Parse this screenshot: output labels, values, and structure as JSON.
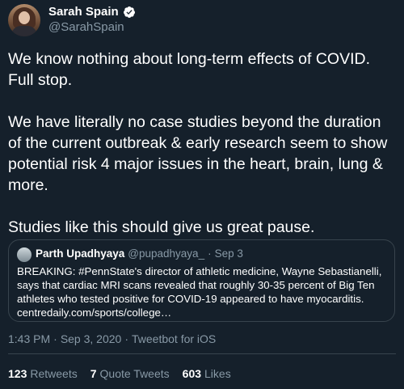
{
  "author": {
    "name": "Sarah Spain",
    "handle": "@SarahSpain",
    "avatar_icon": "profile-photo",
    "verified_icon": "verified-badge-icon"
  },
  "tweet": {
    "text": "We know nothing about long-term effects of COVID. Full stop.\n\nWe have literally no case studies beyond the duration of the current outbreak & early research seem to show potential risk 4 major issues in the heart, brain, lung & more.\n\nStudies like this should give us great pause."
  },
  "quoted": {
    "name": "Parth Upadhyaya",
    "handle": "@pupadhyaya_",
    "separator": "·",
    "date": "Sep 3",
    "text": "BREAKING: #PennState's director of athletic medicine, Wayne Sebastianelli, says that cardiac MRI scans revealed that roughly 30-35 percent of Big Ten athletes who tested positive for COVID-19 appeared to have myocarditis. centredaily.com/sports/college…"
  },
  "meta": {
    "time": "1:43 PM",
    "separator": "·",
    "date": "Sep 3, 2020",
    "separator2": "·",
    "client": "Tweetbot for iOS"
  },
  "stats": {
    "retweets_count": "123",
    "retweets_label": "Retweets",
    "quotes_count": "7",
    "quotes_label": "Quote Tweets",
    "likes_count": "603",
    "likes_label": "Likes"
  },
  "colors": {
    "background": "#15202b",
    "secondary_text": "#8899a6",
    "border": "#38444d",
    "verified": "#1da1f2"
  }
}
